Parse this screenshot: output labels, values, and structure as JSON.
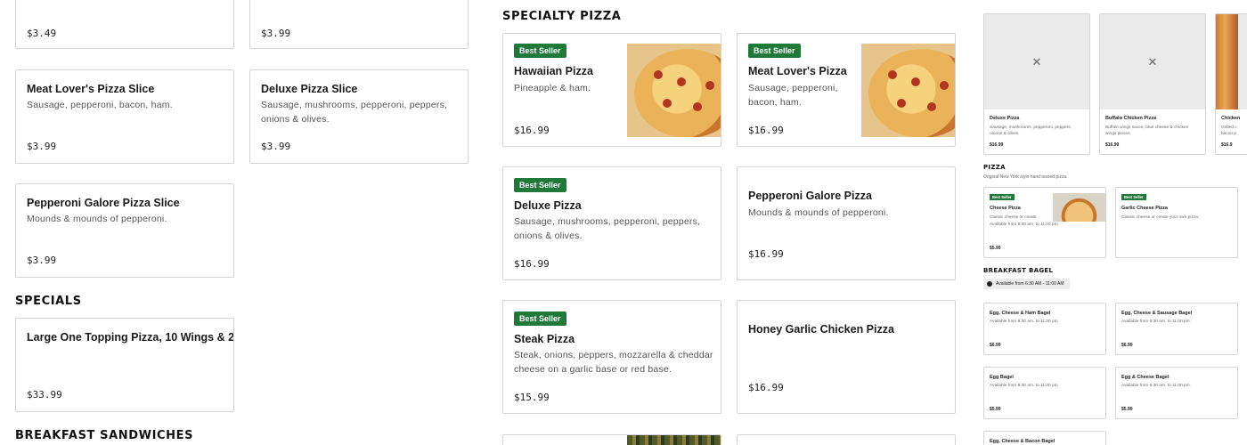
{
  "left_column": {
    "top_cards": [
      {
        "price": "$3.49"
      },
      {
        "price": "$3.99"
      }
    ],
    "slice_cards": [
      {
        "name": "Meat Lover's Pizza Slice",
        "desc": "Sausage, pepperoni, bacon, ham.",
        "price": "$3.99"
      },
      {
        "name": "Deluxe Pizza Slice",
        "desc": "Sausage, mushrooms, pepperoni, peppers, onions & olives.",
        "price": "$3.99"
      },
      {
        "name": "Pepperoni Galore Pizza Slice",
        "desc": "Mounds & mounds of pepperoni.",
        "price": "$3.99"
      }
    ],
    "specials": {
      "title": "SPECIALS",
      "items": [
        {
          "name": "Large One Topping Pizza, 10 Wings & 2...",
          "price": "$33.99"
        }
      ]
    },
    "breakfast_sandwiches": {
      "title": "BREAKFAST SANDWICHES"
    }
  },
  "specialty_pizza": {
    "title": "SPECIALTY PIZZA",
    "badge": "Best Seller",
    "items": [
      {
        "name": "Hawaiian Pizza",
        "desc": "Pineapple & ham.",
        "price": "$16.99",
        "best_seller": true,
        "image": "pizza-photo"
      },
      {
        "name": "Meat Lover's Pizza",
        "desc": "Sausage, pepperoni, bacon, ham.",
        "price": "$16.99",
        "best_seller": true,
        "image": "pizza-photo"
      },
      {
        "name": "Deluxe Pizza",
        "desc": "Sausage, mushrooms, pepperoni, peppers, onions & olives.",
        "price": "$16.99",
        "best_seller": true
      },
      {
        "name": "Pepperoni Galore Pizza",
        "desc": "Mounds & mounds of pepperoni.",
        "price": "$16.99",
        "best_seller": false
      },
      {
        "name": "Steak Pizza",
        "desc": "Steak, onions, peppers, mozzarella & cheddar cheese on a garlic base or red base.",
        "price": "$15.99",
        "best_seller": true
      },
      {
        "name": "Honey Garlic Chicken Pizza",
        "desc": "",
        "price": "$16.99",
        "best_seller": false
      }
    ]
  },
  "preview_panel": {
    "carousel": [
      {
        "name": "Deluxe Pizza",
        "desc": "Sausage, mushrooms, pepperoni, peppers, onions & olives.",
        "price": "$16.99",
        "icon": "utensils-icon"
      },
      {
        "name": "Buffalo Chicken Pizza",
        "desc": "Buffalo wings sauce, blue cheese & chicken wings pieces.",
        "price": "$16.99",
        "icon": "utensils-icon"
      },
      {
        "name": "Chicken",
        "desc": "Grilled c bacon p",
        "price": "$16.9"
      }
    ],
    "pizza_section": {
      "title": "PIZZA",
      "subtitle": "Original New York style hand tossed pizza.",
      "items": [
        {
          "badge": "Best Seller",
          "name": "Cheese Pizza",
          "desc": "Classic cheese or create",
          "avail": "Available from 6:30 am. to 11:00 pm.",
          "price": "$5.99"
        },
        {
          "badge": "Best Seller",
          "name": "Garlic Cheese Pizza",
          "desc": "Classic cheese or create your own pizza."
        }
      ]
    },
    "bagel_section": {
      "title": "BREAKFAST BAGEL",
      "availability": "Available from 6:30 AM - 11:00 AM",
      "items": [
        {
          "name": "Egg, Cheese & Ham Bagel",
          "avail": "Available from 6:30 am. to 11:00 pm.",
          "price": "$6.99"
        },
        {
          "name": "Egg, Cheese & Sausage Bagel",
          "avail": "Available from 6:30 am. to 11:00 pm.",
          "price": "$6.99"
        },
        {
          "name": "Egg Bagel",
          "avail": "Available from 6:30 am. to 11:00 pm.",
          "price": "$5.99"
        },
        {
          "name": "Egg & Cheese Bagel",
          "avail": "Available from 6:30 am. to 11:00 pm.",
          "price": "$5.99"
        },
        {
          "name": "Egg, Cheese & Bacon Bagel"
        }
      ]
    }
  }
}
